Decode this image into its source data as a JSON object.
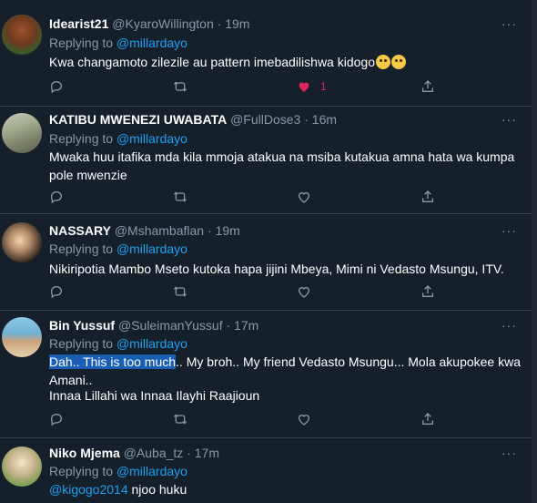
{
  "tweets": [
    {
      "name": "Idearist21",
      "handle": "@KyaroWillington",
      "sep": "·",
      "time": "19m",
      "replying_prefix": "Replying to",
      "replying_to": "@millardayo",
      "text": "Kwa changamoto zilezile au pattern imebadilishwa kidogo",
      "like_count": "1",
      "liked": true
    },
    {
      "name": "KATIBU MWENEZI UWABATA",
      "handle": "@FullDose3",
      "sep": "·",
      "time": "16m",
      "replying_prefix": "Replying to",
      "replying_to": "@millardayo",
      "text": "Mwaka huu itafika mda kila mmoja atakua na msiba kutakua amna hata wa kumpa pole mwenzie"
    },
    {
      "name": "NASSARY",
      "handle": "@Mshambaflan",
      "sep": "·",
      "time": "19m",
      "replying_prefix": "Replying to",
      "replying_to": "@millardayo",
      "text": "Nikiripotia Mambo Mseto kutoka hapa jijini Mbeya, Mimi ni Vedasto Msungu, ITV."
    },
    {
      "name": "Bin Yussuf",
      "handle": "@SuleimanYussuf",
      "sep": "·",
      "time": "17m",
      "replying_prefix": "Replying to",
      "replying_to": "@millardayo",
      "text_highlight": "Dah.. This is too much",
      "text_rest": ".. My broh.. My friend Vedasto Msungu... Mola akupokee kwa Amani..",
      "text_line2": "Innaa Lillahi wa Innaa Ilayhi Raajioun"
    },
    {
      "name": "Niko Mjema",
      "handle": "@Auba_tz",
      "sep": "·",
      "time": "17m",
      "replying_prefix": "Replying to",
      "replying_to": "@millardayo",
      "text_mention": "@kigogo2014",
      "text_rest": " njoo huku"
    }
  ],
  "more_label": "···",
  "colors": {
    "background": "#15202b",
    "accent": "#1da1f2",
    "secondary_text": "#8899a6",
    "like": "#e0245e",
    "divider": "#38444d"
  },
  "icons": [
    "reply-icon",
    "retweet-icon",
    "like-icon",
    "share-icon",
    "more-icon"
  ]
}
